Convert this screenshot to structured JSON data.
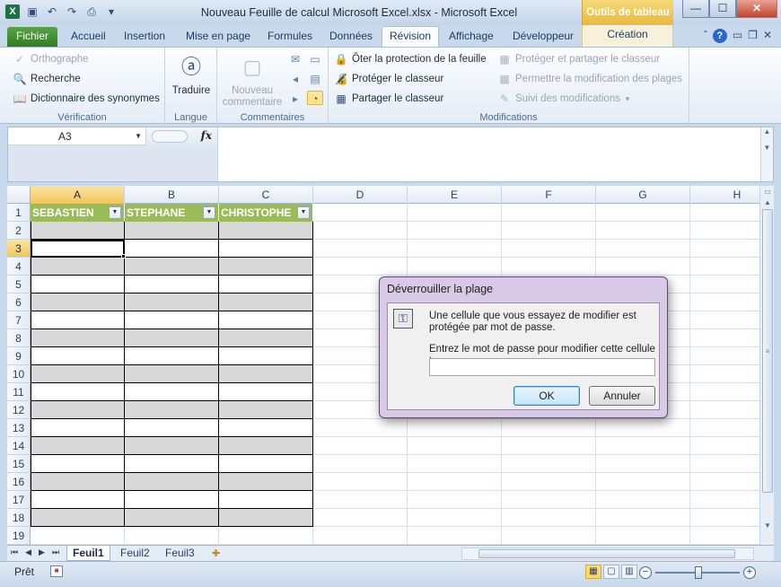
{
  "window": {
    "title": "Nouveau Feuille de calcul Microsoft Excel.xlsx  -  Microsoft Excel",
    "contextual_tab_group": "Outils de tableau",
    "min": "—",
    "max": "☐",
    "close": "✕"
  },
  "tabs": {
    "file": "Fichier",
    "items": [
      "Accueil",
      "Insertion",
      "Mise en page",
      "Formules",
      "Données",
      "Révision",
      "Affichage",
      "Développeur"
    ],
    "active": "Révision",
    "contextual": "Création"
  },
  "ribbon": {
    "verification": {
      "label": "Vérification",
      "spelling": "Orthographe",
      "research": "Recherche",
      "thesaurus": "Dictionnaire des synonymes"
    },
    "language": {
      "label": "Langue",
      "translate": "Traduire"
    },
    "comments": {
      "label": "Commentaires",
      "new_comment_line1": "Nouveau",
      "new_comment_line2": "commentaire"
    },
    "changes": {
      "label": "Modifications",
      "unprotect_sheet": "Ôter la protection de la feuille",
      "protect_workbook": "Protéger le classeur",
      "share_workbook": "Partager le classeur",
      "protect_share": "Protéger et partager le classeur",
      "allow_edit_ranges": "Permettre la modification des plages",
      "track_changes": "Suivi des modifications"
    }
  },
  "formula_bar": {
    "name_box": "A3",
    "fx": "fx",
    "formula": ""
  },
  "sheet": {
    "columns": [
      "A",
      "B",
      "C",
      "D",
      "E",
      "F",
      "G",
      "H"
    ],
    "rows": [
      "1",
      "2",
      "3",
      "4",
      "5",
      "6",
      "7",
      "8",
      "9",
      "10",
      "11",
      "12",
      "13",
      "14",
      "15",
      "16",
      "17",
      "18",
      "19"
    ],
    "table_headers": [
      "SEBASTIEN",
      "STEPHANE",
      "CHRISTOPHE"
    ],
    "selected_cell": "A3",
    "filter_glyph": "▼"
  },
  "sheet_tabs": {
    "items": [
      "Feuil1",
      "Feuil2",
      "Feuil3"
    ],
    "active": "Feuil1"
  },
  "status": {
    "ready": "Prêt"
  },
  "dialog": {
    "title": "Déverrouiller la plage",
    "message": "Une cellule que vous essayez de modifier est protégée par mot de passe.",
    "prompt": "Entrez le mot de passe pour modifier cette cellule :",
    "password_value": "",
    "ok": "OK",
    "cancel": "Annuler"
  },
  "colors": {
    "table_header": "#9bbb59",
    "banded_row": "#d8d8d8",
    "file_tab": "#2f7d23",
    "contextual": "#e9b93c"
  }
}
